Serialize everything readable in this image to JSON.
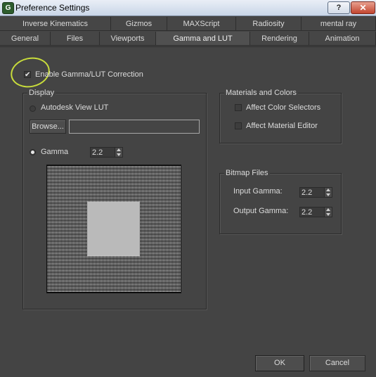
{
  "window": {
    "app_icon": "G",
    "title": "Preference Settings",
    "help_label": "?",
    "close_label": "✕"
  },
  "tabs_row1": [
    "Inverse Kinematics",
    "Gizmos",
    "MAXScript",
    "Radiosity",
    "mental ray"
  ],
  "tabs_row2": [
    "General",
    "Files",
    "Viewports",
    "Gamma and LUT",
    "Rendering",
    "Animation"
  ],
  "active_tab": "Gamma and LUT",
  "enable_gamma": {
    "checked": true,
    "label": "Enable Gamma/LUT Correction"
  },
  "display": {
    "title": "Display",
    "lut_option": "Autodesk View LUT",
    "browse_label": "Browse...",
    "lut_path": "",
    "gamma_option": "Gamma",
    "gamma_value": "2.2",
    "selected": "Gamma"
  },
  "materials": {
    "title": "Materials and Colors",
    "affect_color_selectors": {
      "label": "Affect Color Selectors",
      "checked": false
    },
    "affect_material_editor": {
      "label": "Affect Material Editor",
      "checked": false
    }
  },
  "bitmap": {
    "title": "Bitmap Files",
    "input_gamma_label": "Input Gamma:",
    "input_gamma_value": "2.2",
    "output_gamma_label": "Output Gamma:",
    "output_gamma_value": "2.2"
  },
  "footer": {
    "ok_label": "OK",
    "cancel_label": "Cancel"
  },
  "check_glyph": "✔"
}
